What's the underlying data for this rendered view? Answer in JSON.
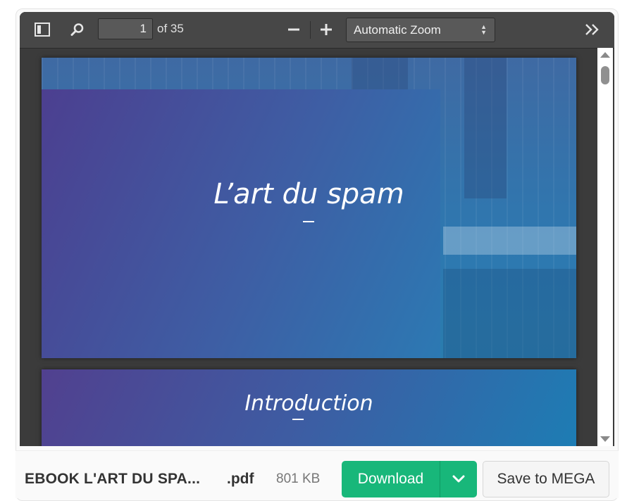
{
  "toolbar": {
    "sidebar_icon": "sidebar-toggle-icon",
    "search_icon": "search-icon",
    "page_number": "1",
    "page_count": "of 35",
    "zoom_out_icon": "minus-icon",
    "zoom_in_icon": "plus-icon",
    "zoom_value": "Automatic Zoom",
    "tools_icon": "double-chevron-right-icon"
  },
  "document": {
    "pages": [
      {
        "title": "L’art du spam"
      },
      {
        "title": "Introduction"
      }
    ]
  },
  "footer": {
    "file_name": "EBOOK L'ART DU SPA...",
    "file_ext": ".pdf",
    "file_size": "801 KB",
    "download_label": "Download",
    "save_label": "Save to MEGA"
  },
  "colors": {
    "download_green": "#18b77a",
    "toolbar_gray": "#474747",
    "viewer_bg": "#3b3b3b"
  }
}
